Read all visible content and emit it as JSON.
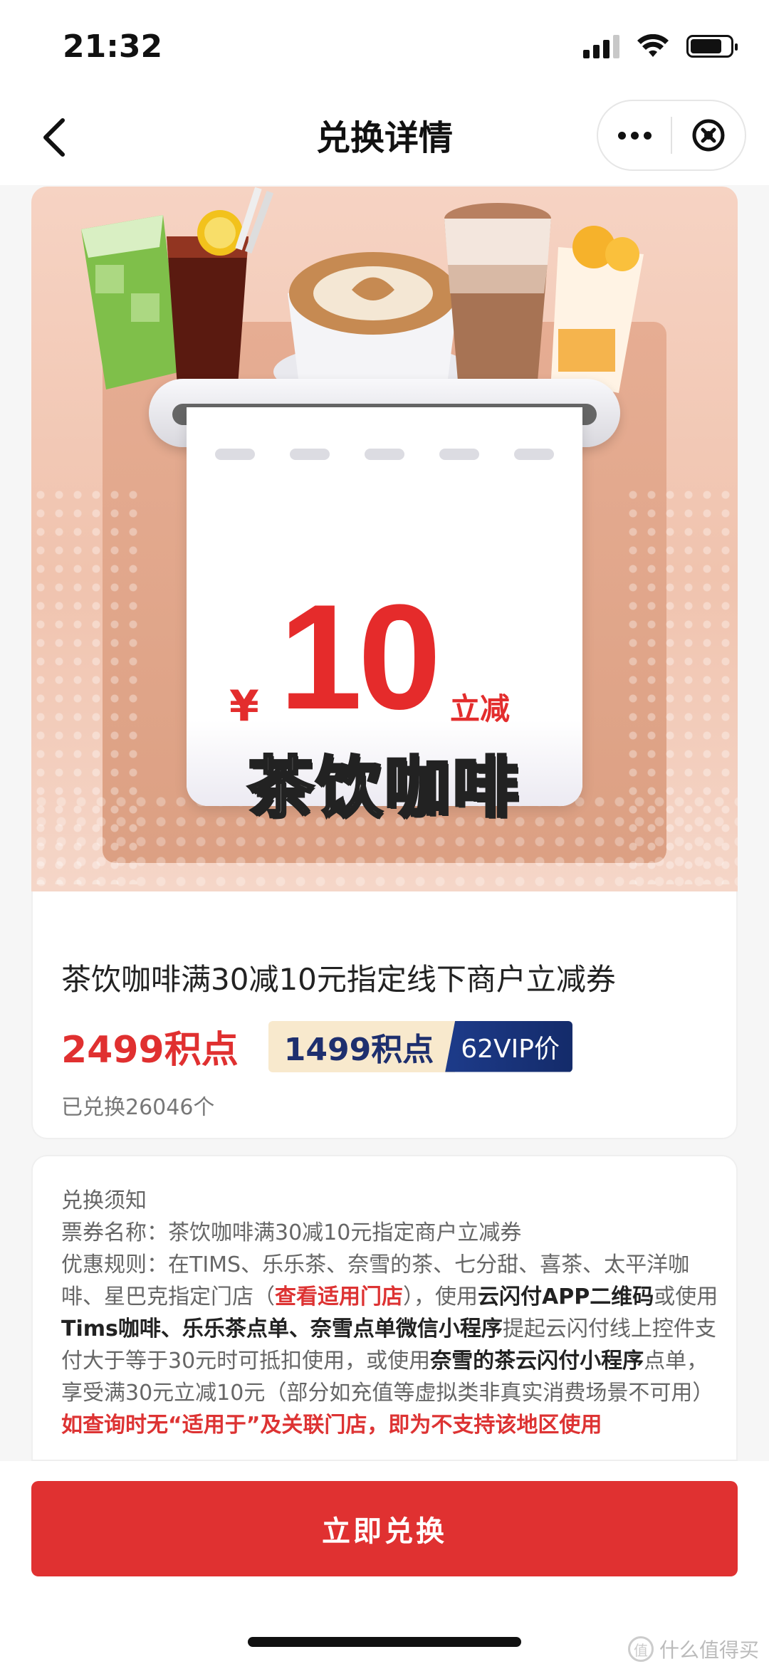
{
  "status_bar": {
    "time": "21:32",
    "signal_bars": 3,
    "battery_level": 0.8
  },
  "nav": {
    "title": "兑换详情",
    "back_icon": "chevron-left-icon",
    "more_icon": "more-icon",
    "close_icon": "close-circle-icon"
  },
  "banner": {
    "currency": "¥",
    "amount": "10",
    "tag": "立减",
    "name": "茶饮咖啡"
  },
  "product": {
    "title": "茶饮咖啡满30减10元指定线下商户立减券",
    "price_points": "2499积点",
    "vip_points": "1499积点",
    "vip_label": "62VIP价",
    "redeemed": "已兑换26046个"
  },
  "notice": {
    "heading": "兑换须知",
    "ticket_name_label": "票券名称：",
    "ticket_name": "茶饮咖啡满30减10元指定商户立减券",
    "rule_label": "优惠规则：",
    "rule_part1": "在TIMS、乐乐茶、奈雪的茶、七分甜、喜茶、太平洋咖啡、星巴克",
    "rule_part2": "指定门店（",
    "rule_link": "查看适用门店",
    "rule_part3": "），使用",
    "rule_hl1": "云闪付APP二维码",
    "rule_part4": "或使用",
    "rule_hl2": "Tims咖啡、乐乐茶点单、奈雪点单微信小程序",
    "rule_part5": "提起云闪付线上控件支付大于等于30元时可抵扣使用，或使用",
    "rule_hl3": "奈雪的茶云闪付小程序",
    "rule_part6": "点单，享受满30元立减10元（部分如充值等虚拟类非真实消费场景不可用）",
    "warning": "如查询时无“适用于”及关联门店，即为不支持该地区使用"
  },
  "actions": {
    "redeem_label": "立即兑换"
  },
  "watermark": {
    "logo": "值",
    "text": "什么值得买"
  },
  "colors": {
    "accent": "#e03131",
    "vip_dark": "#1e2f6e",
    "vip_light": "#f8e9cd"
  }
}
